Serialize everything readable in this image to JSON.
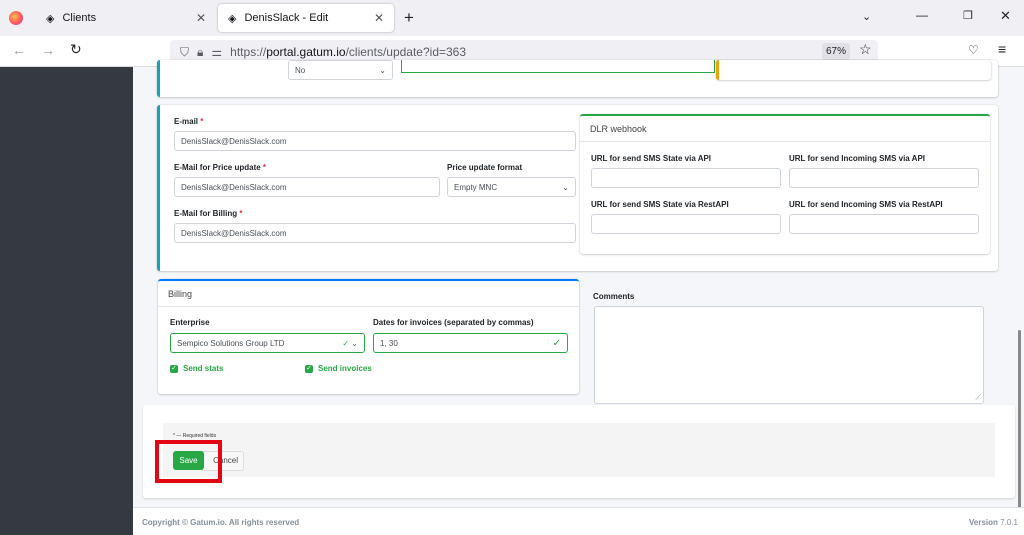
{
  "browser": {
    "tabs": [
      {
        "label": "Clients"
      },
      {
        "label": "DenisSlack - Edit"
      }
    ],
    "url": "https://portal.gatum.io/clients/update?id=363",
    "url_host": "portal.gatum.io",
    "url_pre": "https://",
    "url_post": "/clients/update?id=363",
    "zoom": "67%"
  },
  "top": {
    "select_value": "No"
  },
  "contact": {
    "email_label": "E-mail",
    "email": "DenisSlack@DenisSlack.com",
    "price_email_label": "E-Mail for Price update",
    "price_email": "DenisSlack@DenisSlack.com",
    "price_format_label": "Price update format",
    "price_format": "Empty MNC",
    "billing_email_label": "E-Mail for Billing",
    "billing_email": "DenisSlack@DenisSlack.com",
    "req": "*"
  },
  "dlr": {
    "title": "DLR webhook",
    "f1": "URL for send SMS State via API",
    "f2": "URL for send Incoming SMS via API",
    "f3": "URL for send SMS State via RestAPI",
    "f4": "URL for send Incoming SMS via RestAPI"
  },
  "billing": {
    "title": "Billing",
    "enterprise_label": "Enterprise",
    "enterprise": "Sempico Solutions Group LTD",
    "dates_label": "Dates for invoices (separated by commas)",
    "dates": "1, 30",
    "send_stats": "Send stats",
    "send_invoices": "Send invoices"
  },
  "comments": {
    "label": "Comments"
  },
  "actions": {
    "required_note": "* — Required fields",
    "save": "Save",
    "cancel": "Cancel"
  },
  "footer": {
    "copyright": "Copyright © Gatum.io. All rights reserved",
    "version_label": "Version",
    "version": "7.0.1"
  },
  "colors": {
    "accent": "#28a745",
    "teal": "#17a2b8",
    "blue": "#007bff",
    "highlight": "#e30613"
  }
}
